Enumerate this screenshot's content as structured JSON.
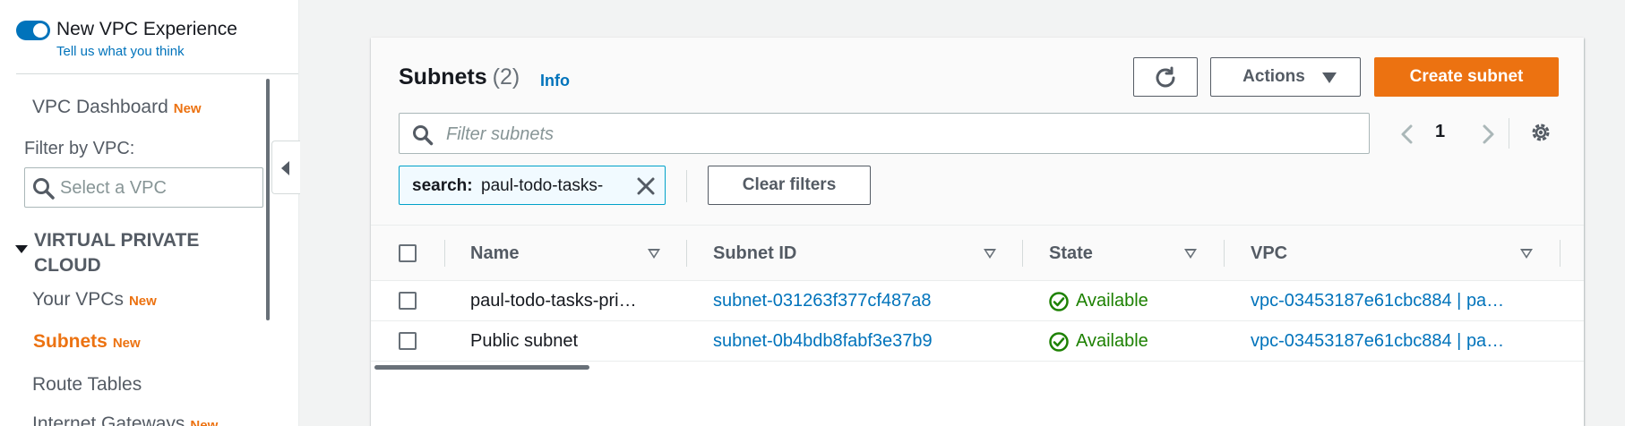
{
  "sidebar": {
    "vpc_experience_title": "New VPC Experience",
    "vpc_experience_link": "Tell us what you think",
    "dashboard": {
      "label": "VPC Dashboard",
      "badge": "New"
    },
    "filter_label": "Filter by VPC:",
    "filter_placeholder": "Select a VPC",
    "section_title": "VIRTUAL PRIVATE CLOUD",
    "items": [
      {
        "label": "Your VPCs",
        "badge": "New"
      },
      {
        "label": "Subnets",
        "badge": "New",
        "active": true
      },
      {
        "label": "Route Tables"
      },
      {
        "label": "Internet Gateways",
        "badge": "New"
      }
    ]
  },
  "header": {
    "title": "Subnets",
    "count": "(2)",
    "info": "Info",
    "actions_label": "Actions",
    "create_label": "Create subnet",
    "search_placeholder": "Filter subnets",
    "page": "1",
    "token_key": "search:",
    "token_value": "paul-todo-tasks-",
    "clear_filters": "Clear filters"
  },
  "table": {
    "columns": [
      "Name",
      "Subnet ID",
      "State",
      "VPC"
    ],
    "rows": [
      {
        "name": "paul-todo-tasks-pri…",
        "subnet_id": "subnet-031263f377cf487a8",
        "state": "Available",
        "vpc": "vpc-03453187e61cbc884 | pa…"
      },
      {
        "name": "Public subnet",
        "subnet_id": "subnet-0b4bdb8fabf3e37b9",
        "state": "Available",
        "vpc": "vpc-03453187e61cbc884 | pa…"
      }
    ]
  },
  "colors": {
    "accent": "#ec7211",
    "link": "#0073bb",
    "success": "#1d8102"
  }
}
